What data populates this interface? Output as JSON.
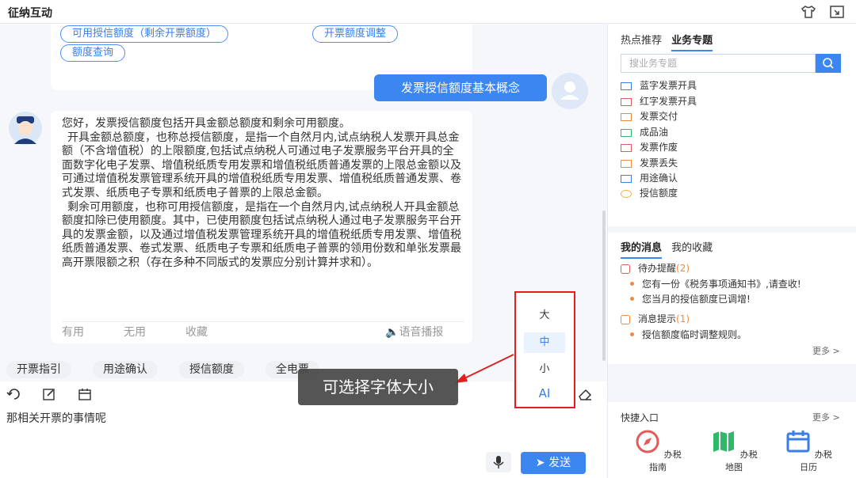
{
  "app": {
    "title": "征纳互动"
  },
  "top_pills": [
    "可用授信额度（剩余开票额度）",
    "开票额度调整",
    "额度查询"
  ],
  "user_message": "发票授信额度基本概念",
  "answer": {
    "paragraphs": [
      "您好，发票授信额度包括开具金额总额度和剩余可用额度。",
      "开具金额总额度，也称总授信额度，是指一个自然月内,试点纳税人发票开具总金额（不含增值税）的上限额度,包括试点纳税人可通过电子发票服务平台开具的全面数字化电子发票、增值税纸质专用发票和增值税纸质普通发票的上限总金额以及可通过增值税发票管理系统开具的增值税纸质专用发票、增值税纸质普通发票、卷式发票、纸质电子专票和纸质电子普票的上限总金额。",
      "剩余可用额度，也称可用授信额度，是指在一个自然月内,试点纳税人开具金额总额度扣除已使用额度。其中，已使用额度包括试点纳税人通过电子发票服务平台开具的发票金额，以及通过增值税发票管理系统开具的增值税纸质专用发票、增值税纸质普通发票、卷式发票、纸质电子专票和纸质电子普票的领用份数和单张发票最高开票限额之积（存在多种不同版式的发票应分别计算并求和）。"
    ],
    "useful": "有用",
    "useless": "无用",
    "favorite": "收藏",
    "voice": "语音播报"
  },
  "quick_chips": [
    "开票指引",
    "用途确认",
    "授信额度",
    "全电票"
  ],
  "input": {
    "text": "那相关开票的事情呢"
  },
  "send_label": "发送",
  "font_size_menu": {
    "large": "大",
    "medium": "中",
    "small": "小",
    "ai": "AI"
  },
  "tooltip": "可选择字体大小",
  "right_panel": {
    "tabs": [
      "热点推荐",
      "业务专题"
    ],
    "search_placeholder": "搜业务专题",
    "topics": [
      "蓝字发票开具",
      "红字发票开具",
      "发票交付",
      "成品油",
      "发票作废",
      "发票丢失",
      "用途确认",
      "授信额度"
    ],
    "msg_tabs": [
      "我的消息",
      "我的收藏"
    ],
    "pending_title": "待办提醒",
    "pending_count": "(2)",
    "pending_items": [
      "您有一份《税务事项通知书》,请查收!",
      "您当月的授信额度已调增!"
    ],
    "notice_title": "消息提示",
    "notice_count": "(1)",
    "notice_items": [
      "授信额度临时调整规则。"
    ],
    "more1": "更多 >",
    "quick_entry_title": "快捷入口",
    "more2": "更多 >",
    "quick_entries": [
      "办税指南",
      "办税地图",
      "办税日历"
    ]
  }
}
